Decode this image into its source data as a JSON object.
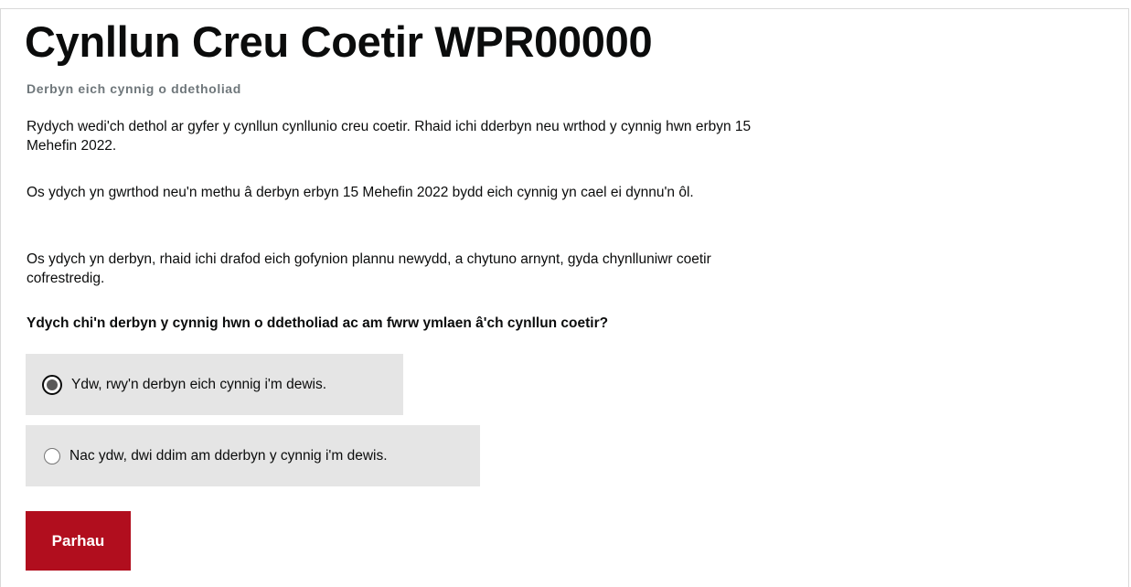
{
  "page": {
    "title": "Cynllun Creu Coetir WPR00000",
    "caption": "Derbyn eich cynnig o ddetholiad"
  },
  "body": {
    "paragraph_1": "Rydych wedi'ch dethol ar gyfer y cynllun cynllunio creu coetir. Rhaid ichi dderbyn neu wrthod y cynnig hwn erbyn 15 Mehefin 2022.",
    "paragraph_2": "Os ydych yn gwrthod neu'n methu â derbyn erbyn 15 Mehefin 2022 bydd eich cynnig yn cael ei dynnu'n ôl.",
    "paragraph_3": "Os ydych yn derbyn, rhaid ichi drafod eich gofynion plannu newydd, a chytuno arnynt, gyda chynlluniwr coetir cofrestredig."
  },
  "form": {
    "question": "Ydych chi'n derbyn y cynnig hwn o ddetholiad ac am fwrw ymlaen â'ch cynllun coetir?",
    "options": [
      {
        "label": "Ydw, rwy'n derbyn eich cynnig i'm dewis.",
        "selected": true
      },
      {
        "label": "Nac ydw, dwi ddim am dderbyn y cynnig i'm dewis.",
        "selected": false
      }
    ],
    "submit_label": "Parhau",
    "submit_color": "#b10e1e"
  }
}
